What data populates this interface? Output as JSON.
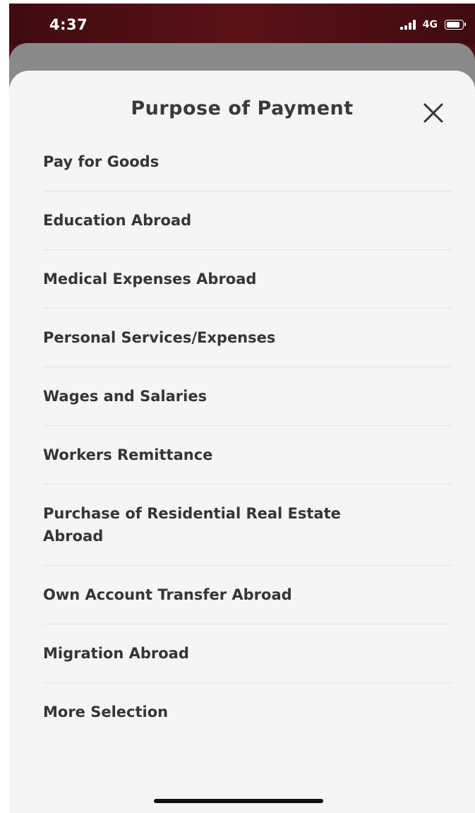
{
  "status_bar": {
    "time": "4:37",
    "network": "4G"
  },
  "sheet": {
    "title": "Purpose of Payment",
    "close_icon": "close-icon",
    "items": [
      "Pay for Goods",
      "Education Abroad",
      "Medical Expenses Abroad",
      "Personal Services/Expenses",
      "Wages and Salaries",
      "Workers Remittance",
      "Purchase of Residential Real Estate Abroad",
      "Own Account Transfer Abroad",
      "Migration Abroad",
      "More Selection"
    ]
  },
  "colors": {
    "brand_dark": "#4a0f14",
    "sheet_background": "#f5f5f5",
    "text": "#353535"
  }
}
